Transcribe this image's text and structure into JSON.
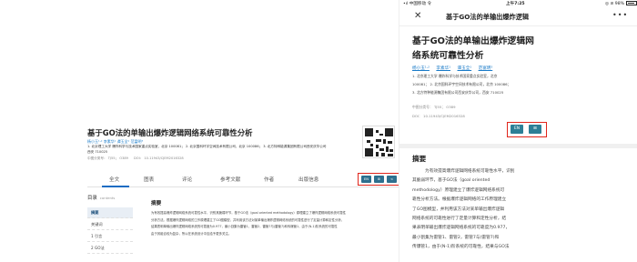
{
  "desktop": {
    "title": "基于GO法的单输出爆炸逻辑网络系统可靠性分析",
    "authors": "杨小玉¹·²  李素华¹  谭玉全¹  范富明³",
    "affiliations_1": "1. 北京理工大学 爆炸科学与技术国家重点实验室，北京 100081；  2. 北京国科环宇空间技术有限公司，北京 100086；  3. 北方特种能源集团有限公司西安庆华公司",
    "affiliations_2": "西安 710025",
    "class_no": "中图分类号： TJ55； O389",
    "doi": "DOI： 10.11943/CJEM2016328",
    "tabs": [
      "全文",
      "图表",
      "评论",
      "参考文献",
      "作者",
      "出版信息"
    ],
    "buttons": [
      "EN",
      "⊞",
      "<"
    ],
    "toc_title": "目录",
    "toc_subtitle": "contents",
    "toc_items": [
      "摘要",
      "关键词",
      "1 引言",
      "2 GO法"
    ],
    "abstract_title": "摘要",
    "abstract_lines": [
      "为有效提高爆炸逻辑网络系统可靠性水平，识别其脆弱环节，基于GO法（goal oriented methodology）原理建立了爆炸逻辑网络系统可靠性",
      "分析方法。根据爆炸逻辑网络的工作原理建立了GO图模型，并利用该方法对某单输出爆炸逻辑网络系统的可靠性进行了定量计算和定性分析，",
      "结果表明单输出爆炸逻辑网络系统的可靠度为0.977，最小割集为雷管1、雷管2，雷管7与(雷管7)和传爆管1，由于(N-1)阶系统的可靠性",
      "由于其组合较为复杂，所以在系统设计中应给予更多关注。"
    ]
  },
  "mobile": {
    "status": {
      "carrier": "•ıl 中国移动 令",
      "time": "上午7:25",
      "battery": "◎ ⊘ 98%"
    },
    "nav_title": "基于GO法的单输出爆炸逻辑",
    "close_glyph": "✕",
    "more_glyph": "•••",
    "title_line1": "基于GO法的单输出爆炸逻辑网",
    "title_line2": "络系统可靠性分析",
    "authors": [
      "杨小玉¹·²",
      "李素华¹",
      "谭玉全¹",
      "范富明³"
    ],
    "aff_lines": [
      "1. 北京理工大学 爆炸科学与技术国家重点实验室，北京",
      "100081；  2. 北京国科环宇空间技术有限公司，北京 100086；",
      "3. 北方特种能源集团有限公司西安庆华公司，西安 710025"
    ],
    "class_no": "中图分类号： TJ55； O389",
    "doi": "DOI： 10.11943/CJEM2016328",
    "buttons": [
      "EN",
      "⊞"
    ],
    "abstract_title": "摘要",
    "abstract_lines": [
      "为有效提高爆炸逻辑网络系统可靠性水平，识别",
      "其脆弱环节，基于GO法（goal oriented",
      "methodology）原理建立了爆炸逻辑网络系统可",
      "靠性分析方法。根据爆炸逻辑网络的工作原理建立",
      "了GO图模型，并利用该方法对某单输出爆炸逻辑",
      "网络系统的可靠性进行了定量计算和定性分析，结",
      "果表明单输出爆炸逻辑网络系统的可靠度为0.977，",
      "最小割集为雷管1、雷管2，雷管7与(雷管7)和",
      "传爆管1，由于(N-1)阶系统的可靠性，结果与GO法"
    ]
  },
  "colors": {
    "accent_blue": "#1a6cc2",
    "button_teal": "#2d7f96",
    "highlight_red": "#e0251b"
  }
}
